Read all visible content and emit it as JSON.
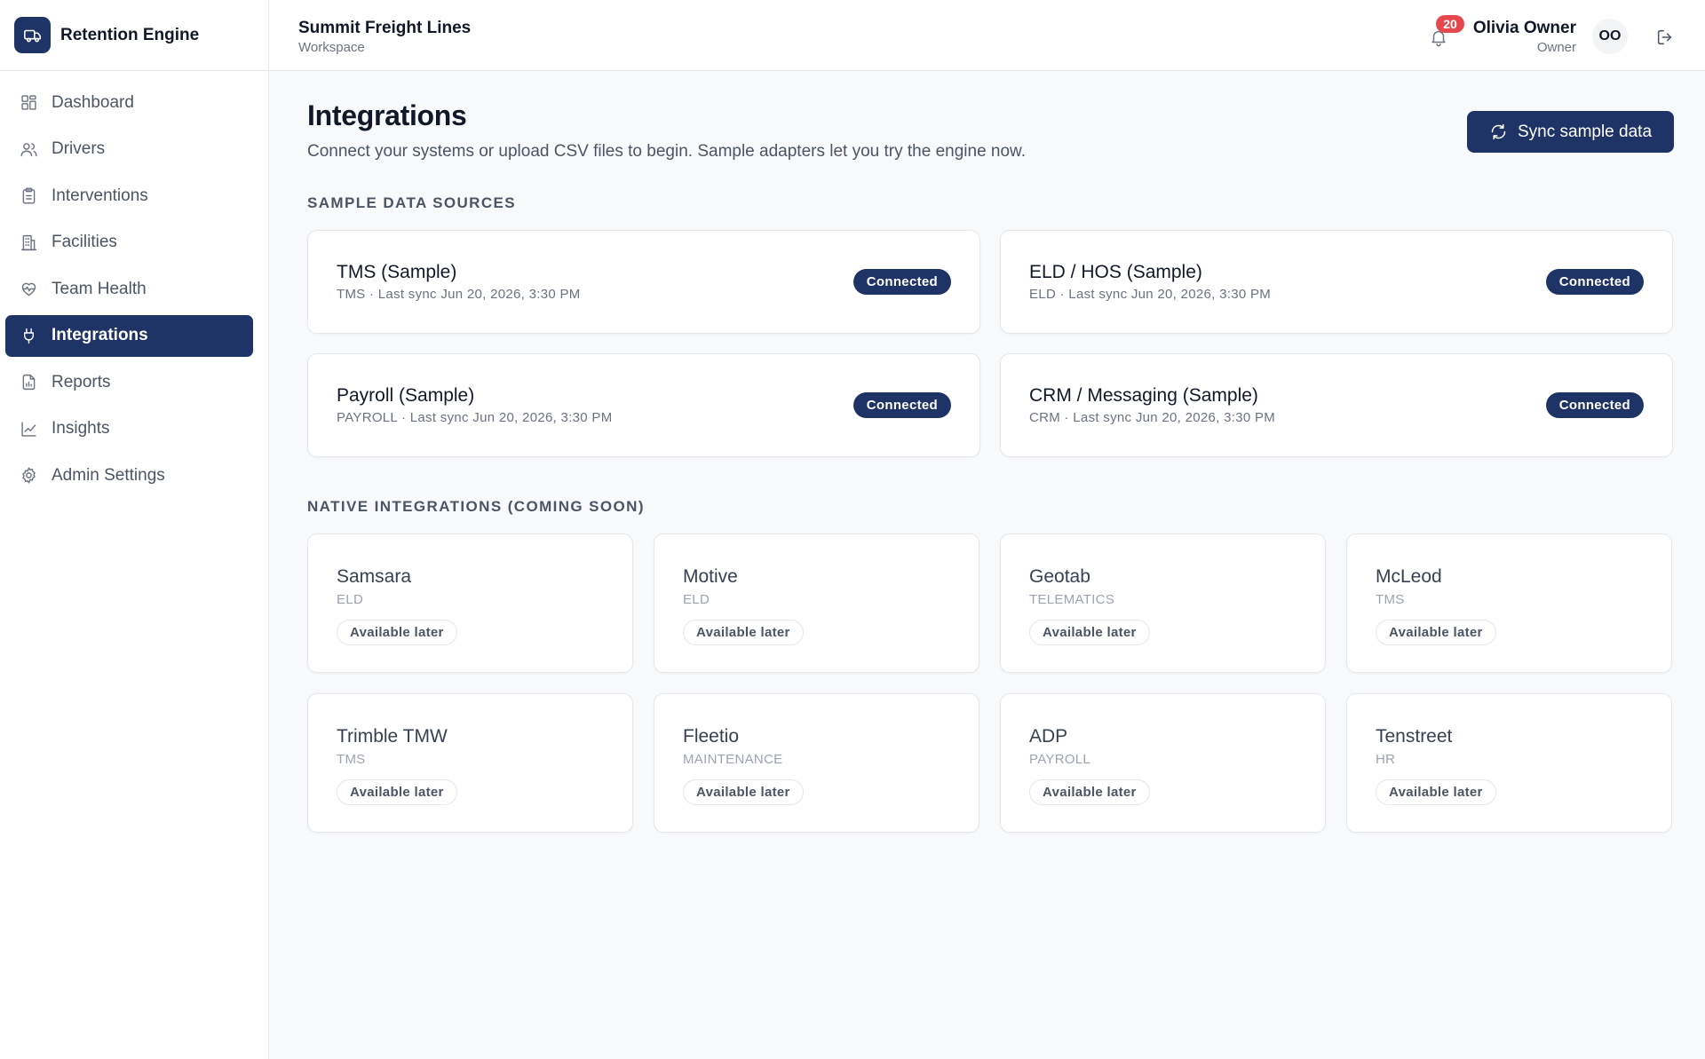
{
  "brand": {
    "name": "Retention Engine",
    "logo_icon": "truck-icon"
  },
  "sidebar": {
    "items": [
      {
        "label": "Dashboard",
        "icon": "dashboard-icon",
        "active": false
      },
      {
        "label": "Drivers",
        "icon": "users-icon",
        "active": false
      },
      {
        "label": "Interventions",
        "icon": "clipboard-icon",
        "active": false
      },
      {
        "label": "Facilities",
        "icon": "building-icon",
        "active": false
      },
      {
        "label": "Team Health",
        "icon": "heart-pulse-icon",
        "active": false
      },
      {
        "label": "Integrations",
        "icon": "plug-icon",
        "active": true
      },
      {
        "label": "Reports",
        "icon": "file-chart-icon",
        "active": false
      },
      {
        "label": "Insights",
        "icon": "line-chart-icon",
        "active": false
      },
      {
        "label": "Admin Settings",
        "icon": "gear-icon",
        "active": false
      }
    ]
  },
  "header": {
    "org_name": "Summit Freight Lines",
    "org_sub": "Workspace",
    "notifications_count": "20",
    "user_name": "Olivia Owner",
    "user_role": "Owner",
    "avatar_initials": "OO"
  },
  "main": {
    "title": "Integrations",
    "description": "Connect your systems or upload CSV files to begin. Sample adapters let you try the engine now.",
    "sync_button": "Sync sample data",
    "sample_section_title": "SAMPLE DATA SOURCES",
    "sample_sources": [
      {
        "name": "TMS (Sample)",
        "meta": "TMS · Last sync Jun 20, 2026, 3:30 PM",
        "status": "Connected"
      },
      {
        "name": "ELD / HOS (Sample)",
        "meta": "ELD · Last sync Jun 20, 2026, 3:30 PM",
        "status": "Connected"
      },
      {
        "name": "Payroll (Sample)",
        "meta": "PAYROLL · Last sync Jun 20, 2026, 3:30 PM",
        "status": "Connected"
      },
      {
        "name": "CRM / Messaging (Sample)",
        "meta": "CRM · Last sync Jun 20, 2026, 3:30 PM",
        "status": "Connected"
      }
    ],
    "native_section_title": "NATIVE INTEGRATIONS (COMING SOON)",
    "native_integrations": [
      {
        "name": "Samsara",
        "type": "ELD",
        "status": "Available later"
      },
      {
        "name": "Motive",
        "type": "ELD",
        "status": "Available later"
      },
      {
        "name": "Geotab",
        "type": "TELEMATICS",
        "status": "Available later"
      },
      {
        "name": "McLeod",
        "type": "TMS",
        "status": "Available later"
      },
      {
        "name": "Trimble TMW",
        "type": "TMS",
        "status": "Available later"
      },
      {
        "name": "Fleetio",
        "type": "MAINTENANCE",
        "status": "Available later"
      },
      {
        "name": "ADP",
        "type": "PAYROLL",
        "status": "Available later"
      },
      {
        "name": "Tenstreet",
        "type": "HR",
        "status": "Available later"
      }
    ]
  },
  "colors": {
    "primary": "#1e3366",
    "badge_red": "#e5484d",
    "background": "#f8f9fb"
  }
}
